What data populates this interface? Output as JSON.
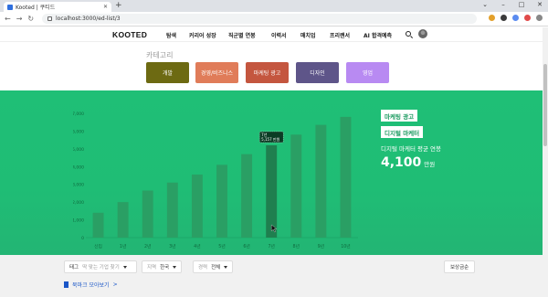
{
  "browser": {
    "tab_title": "Kooted | 쿠티드",
    "new_tab": "+",
    "url": "localhost:3000/ed-list/3",
    "window_controls": [
      "⌄",
      "–",
      "□",
      "✕"
    ]
  },
  "header": {
    "logo": "KOOTED",
    "nav": [
      "탐색",
      "커리어 성장",
      "직군별 연봉",
      "이력서",
      "매치업",
      "프리랜서",
      "AI 합격예측"
    ]
  },
  "category": {
    "title": "카테고리",
    "buttons": [
      {
        "label": "개발",
        "color": "#6d6a12"
      },
      {
        "label": "경영/비즈니스",
        "color": "#e07c59"
      },
      {
        "label": "마케팅 광고",
        "color": "#c4563f"
      },
      {
        "label": "디자인",
        "color": "#5e5589"
      },
      {
        "label": "영업",
        "color": "#b88af2"
      }
    ]
  },
  "chart_data": {
    "type": "bar",
    "categories": [
      "신입",
      "1년",
      "2년",
      "3년",
      "4년",
      "5년",
      "6년",
      "7년",
      "8년",
      "9년",
      "10년"
    ],
    "values": [
      1400,
      2000,
      2650,
      3100,
      3550,
      4100,
      4700,
      5200,
      5800,
      6350,
      6800
    ],
    "yticks": [
      "0",
      "1,000",
      "2,000",
      "3,000",
      "4,000",
      "5,000",
      "6,000",
      "7,000"
    ],
    "ylim": [
      0,
      7000
    ],
    "highlight_index": 7,
    "tooltip": [
      "7년",
      "5,157 만원"
    ],
    "bar_color": "#2a9f64",
    "highlight_color": "#1f7f4f"
  },
  "side_panel": {
    "badge1": "마케팅 광고",
    "badge2": "디지털 마케터",
    "subtitle": "디지털 마케터 평균 연봉",
    "value": "4,100",
    "unit": "만원"
  },
  "filters": {
    "tag_label": "태그",
    "tag_placeholder": "딱 맞는 기업 찾기",
    "region_label": "지역",
    "region_value": "한국",
    "career_label": "경력",
    "career_value": "전체",
    "sort_label": "보상금순"
  },
  "bookmark": {
    "label": "북마크 모아보기",
    "arrow": ">"
  }
}
